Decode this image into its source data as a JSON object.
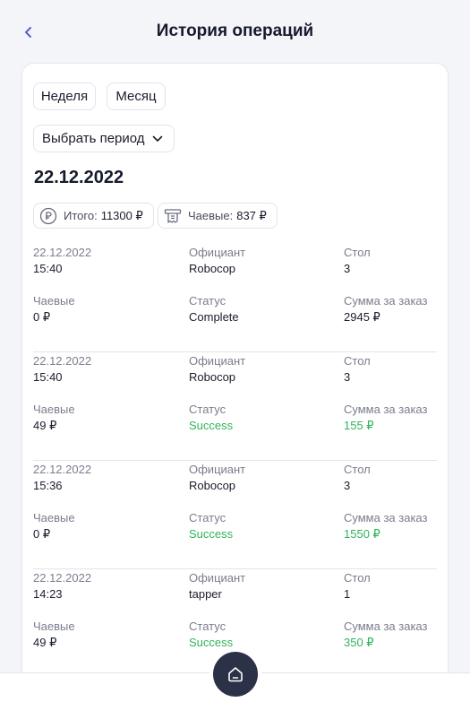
{
  "header": {
    "title": "История операций"
  },
  "filters": {
    "week": "Неделя",
    "month": "Месяц",
    "period": "Выбрать период"
  },
  "date_heading": "22.12.2022",
  "summary": {
    "total_label": "Итого:",
    "total_value": "11300 ₽",
    "tips_label": "Чаевые:",
    "tips_value": "837 ₽"
  },
  "labels": {
    "waiter": "Официант",
    "table": "Стол",
    "tips": "Чаевые",
    "status": "Статус",
    "sum": "Сумма за заказ"
  },
  "operations": [
    {
      "date": "22.12.2022",
      "time": "15:40",
      "waiter": "Robocop",
      "table": "3",
      "tips": "0 ₽",
      "status": "Complete",
      "sum": "2945 ₽"
    },
    {
      "date": "22.12.2022",
      "time": "15:40",
      "waiter": "Robocop",
      "table": "3",
      "tips": "49 ₽",
      "status": "Success",
      "sum": "155 ₽"
    },
    {
      "date": "22.12.2022",
      "time": "15:36",
      "waiter": "Robocop",
      "table": "3",
      "tips": "0 ₽",
      "status": "Success",
      "sum": "1550 ₽"
    },
    {
      "date": "22.12.2022",
      "time": "14:23",
      "waiter": "tapper",
      "table": "1",
      "tips": "49 ₽",
      "status": "Success",
      "sum": "350 ₽"
    }
  ],
  "colors": {
    "accent": "#5a5fd6",
    "success": "#2fb45c",
    "home_button": "#2b3146"
  },
  "icons": {
    "back": "chevron-left-icon",
    "period": "chevron-down-icon",
    "total": "ruble-coin-icon",
    "tips": "receipt-icon",
    "home": "home-icon"
  }
}
